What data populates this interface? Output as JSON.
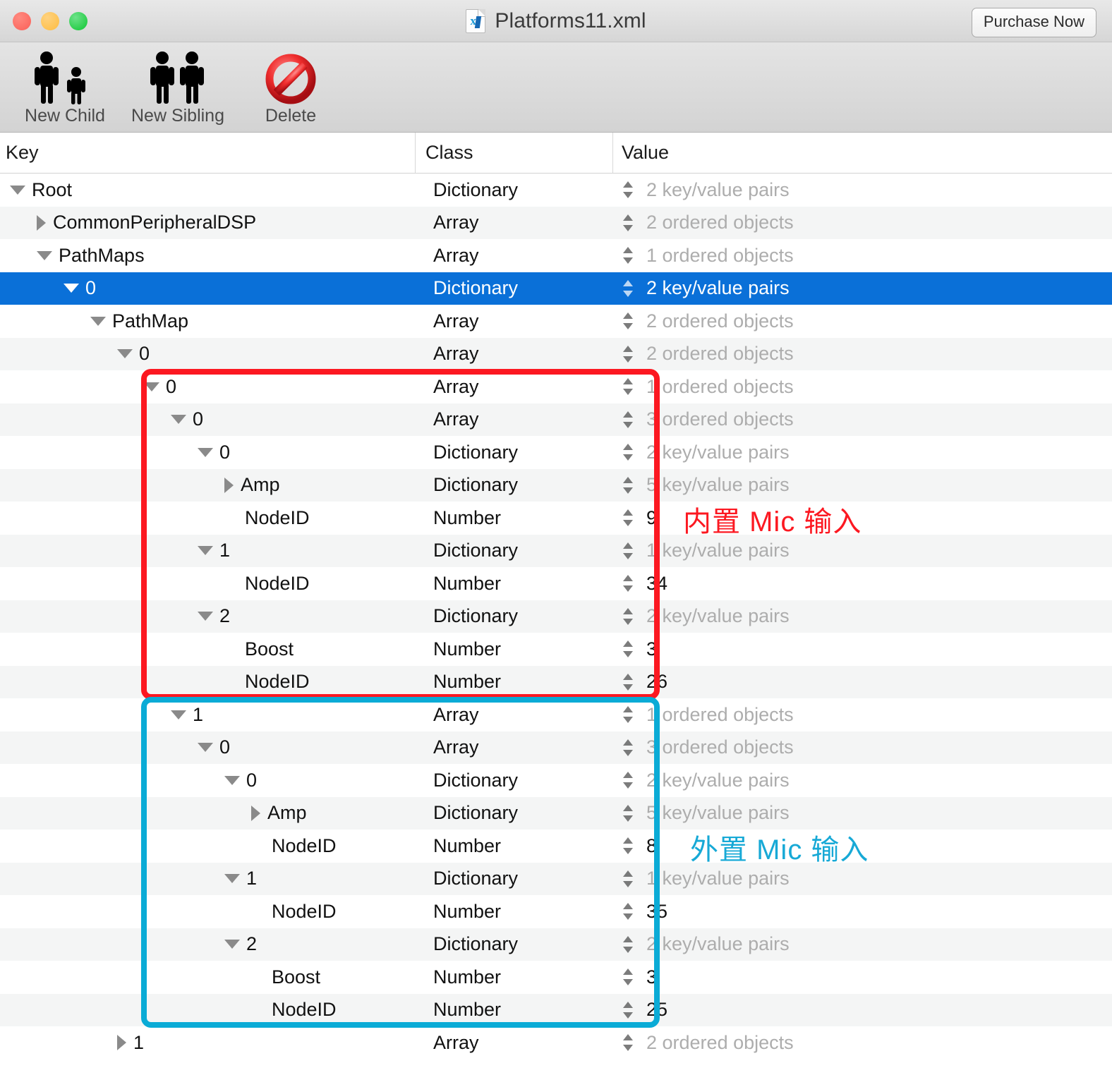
{
  "window": {
    "title": "Platforms11.xml",
    "doc_icon": "xml-document-icon",
    "purchase_label": "Purchase Now",
    "traffic_lights": [
      "close-button",
      "minimize-button",
      "zoom-button"
    ]
  },
  "toolbar": {
    "buttons": [
      {
        "label": "New Child",
        "icon": "adult-and-child-icon"
      },
      {
        "label": "New Sibling",
        "icon": "two-adults-icon"
      },
      {
        "label": "Delete",
        "icon": "no-entry-icon"
      }
    ]
  },
  "table": {
    "columns": [
      "Key",
      "Class",
      "Value"
    ],
    "rows": [
      {
        "indent": 0,
        "disc": "down",
        "key": "Root",
        "class": "Dictionary",
        "stepper": true,
        "value": "2 key/value pairs",
        "muted": true,
        "selected": false
      },
      {
        "indent": 1,
        "disc": "right",
        "key": "CommonPeripheralDSP",
        "class": "Array",
        "stepper": true,
        "value": "2 ordered objects",
        "muted": true,
        "selected": false
      },
      {
        "indent": 1,
        "disc": "down",
        "key": "PathMaps",
        "class": "Array",
        "stepper": true,
        "value": "1 ordered objects",
        "muted": true,
        "selected": false
      },
      {
        "indent": 2,
        "disc": "down",
        "key": "0",
        "class": "Dictionary",
        "stepper": true,
        "value": "2 key/value pairs",
        "muted": false,
        "selected": true
      },
      {
        "indent": 3,
        "disc": "down",
        "key": "PathMap",
        "class": "Array",
        "stepper": true,
        "value": "2 ordered objects",
        "muted": true,
        "selected": false
      },
      {
        "indent": 4,
        "disc": "down",
        "key": "0",
        "class": "Array",
        "stepper": true,
        "value": "2 ordered objects",
        "muted": true,
        "selected": false
      },
      {
        "indent": 5,
        "disc": "down",
        "key": "0",
        "class": "Array",
        "stepper": true,
        "value": "1 ordered objects",
        "muted": true,
        "selected": false
      },
      {
        "indent": 6,
        "disc": "down",
        "key": "0",
        "class": "Array",
        "stepper": true,
        "value": "3 ordered objects",
        "muted": true,
        "selected": false
      },
      {
        "indent": 7,
        "disc": "down",
        "key": "0",
        "class": "Dictionary",
        "stepper": true,
        "value": "2 key/value pairs",
        "muted": true,
        "selected": false
      },
      {
        "indent": 8,
        "disc": "right",
        "key": "Amp",
        "class": "Dictionary",
        "stepper": true,
        "value": "5 key/value pairs",
        "muted": true,
        "selected": false
      },
      {
        "indent": 8,
        "disc": "none",
        "key": "NodeID",
        "class": "Number",
        "stepper": true,
        "value": "9",
        "muted": false,
        "selected": false
      },
      {
        "indent": 7,
        "disc": "down",
        "key": "1",
        "class": "Dictionary",
        "stepper": true,
        "value": "1 key/value pairs",
        "muted": true,
        "selected": false
      },
      {
        "indent": 8,
        "disc": "none",
        "key": "NodeID",
        "class": "Number",
        "stepper": true,
        "value": "34",
        "muted": false,
        "selected": false
      },
      {
        "indent": 7,
        "disc": "down",
        "key": "2",
        "class": "Dictionary",
        "stepper": true,
        "value": "2 key/value pairs",
        "muted": true,
        "selected": false
      },
      {
        "indent": 8,
        "disc": "none",
        "key": "Boost",
        "class": "Number",
        "stepper": true,
        "value": "3",
        "muted": false,
        "selected": false
      },
      {
        "indent": 8,
        "disc": "none",
        "key": "NodeID",
        "class": "Number",
        "stepper": true,
        "value": "26",
        "muted": false,
        "selected": false
      },
      {
        "indent": 6,
        "disc": "down",
        "key": "1",
        "class": "Array",
        "stepper": true,
        "value": "1 ordered objects",
        "muted": true,
        "selected": false
      },
      {
        "indent": 7,
        "disc": "down",
        "key": "0",
        "class": "Array",
        "stepper": true,
        "value": "3 ordered objects",
        "muted": true,
        "selected": false
      },
      {
        "indent": 8,
        "disc": "down",
        "key": "0",
        "class": "Dictionary",
        "stepper": true,
        "value": "2 key/value pairs",
        "muted": true,
        "selected": false
      },
      {
        "indent": 9,
        "disc": "right",
        "key": "Amp",
        "class": "Dictionary",
        "stepper": true,
        "value": "5 key/value pairs",
        "muted": true,
        "selected": false
      },
      {
        "indent": 9,
        "disc": "none",
        "key": "NodeID",
        "class": "Number",
        "stepper": true,
        "value": "8",
        "muted": false,
        "selected": false
      },
      {
        "indent": 8,
        "disc": "down",
        "key": "1",
        "class": "Dictionary",
        "stepper": true,
        "value": "1 key/value pairs",
        "muted": true,
        "selected": false
      },
      {
        "indent": 9,
        "disc": "none",
        "key": "NodeID",
        "class": "Number",
        "stepper": true,
        "value": "35",
        "muted": false,
        "selected": false
      },
      {
        "indent": 8,
        "disc": "down",
        "key": "2",
        "class": "Dictionary",
        "stepper": true,
        "value": "2 key/value pairs",
        "muted": true,
        "selected": false
      },
      {
        "indent": 9,
        "disc": "none",
        "key": "Boost",
        "class": "Number",
        "stepper": true,
        "value": "3",
        "muted": false,
        "selected": false
      },
      {
        "indent": 9,
        "disc": "none",
        "key": "NodeID",
        "class": "Number",
        "stepper": true,
        "value": "25",
        "muted": false,
        "selected": false
      },
      {
        "indent": 4,
        "disc": "right",
        "key": "1",
        "class": "Array",
        "stepper": true,
        "value": "2 ordered objects",
        "muted": true,
        "selected": false
      }
    ]
  },
  "annotations": [
    {
      "name": "red-highlight-box",
      "color": "#fc1821",
      "label": "内置 Mic 输入"
    },
    {
      "name": "cyan-highlight-box",
      "color": "#0aabd6",
      "label": "外置 Mic 输入"
    }
  ]
}
